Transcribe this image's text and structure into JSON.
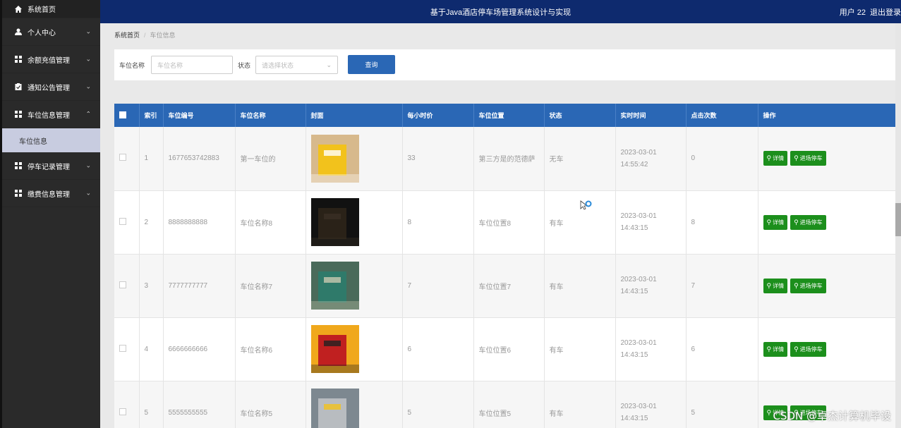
{
  "header": {
    "title": "基于Java酒店停车场管理系统设计与实现",
    "user_label": "用户 22",
    "logout_label": "退出登录"
  },
  "sidebar": {
    "items": [
      {
        "label": "系统首页",
        "icon": "home-icon"
      },
      {
        "label": "个人中心",
        "icon": "user-icon"
      },
      {
        "label": "余额充值管理",
        "icon": "grid-icon"
      },
      {
        "label": "通知公告管理",
        "icon": "notice-icon"
      },
      {
        "label": "车位信息管理",
        "icon": "grid-icon"
      },
      {
        "label": "停车记录管理",
        "icon": "grid-icon"
      },
      {
        "label": "缴费信息管理",
        "icon": "grid-icon"
      }
    ],
    "sub_item": "车位信息"
  },
  "breadcrumb": {
    "home": "系统首页",
    "current": "车位信息"
  },
  "search": {
    "name_label": "车位名称",
    "name_placeholder": "车位名称",
    "status_label": "状态",
    "status_placeholder": "请选择状态",
    "query_button": "查询"
  },
  "table": {
    "headers": [
      "",
      "索引",
      "车位编号",
      "车位名称",
      "封面",
      "每小时价",
      "车位位置",
      "状态",
      "实时时间",
      "点击次数",
      "操作"
    ],
    "detail_label": "详情",
    "enter_label": "进场停车",
    "rows": [
      {
        "index": "1",
        "code": "1677653742883",
        "name": "第一车位的",
        "price": "33",
        "location": "第三方是的范德萨",
        "status": "无车",
        "time": "2023-03-01 14:55:42",
        "clicks": "0",
        "thumb_colors": [
          "#d7b98c",
          "#f2c21c",
          "#ffffff"
        ]
      },
      {
        "index": "2",
        "code": "8888888888",
        "name": "车位名称8",
        "price": "8",
        "location": "车位位置8",
        "status": "有车",
        "time": "2023-03-01 14:43:15",
        "clicks": "8",
        "thumb_colors": [
          "#111111",
          "#2a2218",
          "#3a3025"
        ]
      },
      {
        "index": "3",
        "code": "7777777777",
        "name": "车位名称7",
        "price": "7",
        "location": "车位位置7",
        "status": "有车",
        "time": "2023-03-01 14:43:15",
        "clicks": "7",
        "thumb_colors": [
          "#4a6a5a",
          "#2f7a6a",
          "#c9c9b0"
        ]
      },
      {
        "index": "4",
        "code": "6666666666",
        "name": "车位名称6",
        "price": "6",
        "location": "车位位置6",
        "status": "有车",
        "time": "2023-03-01 14:43:15",
        "clicks": "6",
        "thumb_colors": [
          "#f0a81c",
          "#c02020",
          "#222222"
        ]
      },
      {
        "index": "5",
        "code": "5555555555",
        "name": "车位名称5",
        "price": "5",
        "location": "车位位置5",
        "status": "有车",
        "time": "2023-03-01 14:43:15",
        "clicks": "5",
        "thumb_colors": [
          "#7d8890",
          "#b8bcc0",
          "#f2c21c"
        ]
      }
    ]
  },
  "watermark": "CSDN @卓杰计算机毕设",
  "colors": {
    "header_bg": "#0e2a6e",
    "sidebar_bg": "#2a2a2a",
    "primary_blue": "#2a67b5",
    "action_green": "#1c8f1c"
  }
}
